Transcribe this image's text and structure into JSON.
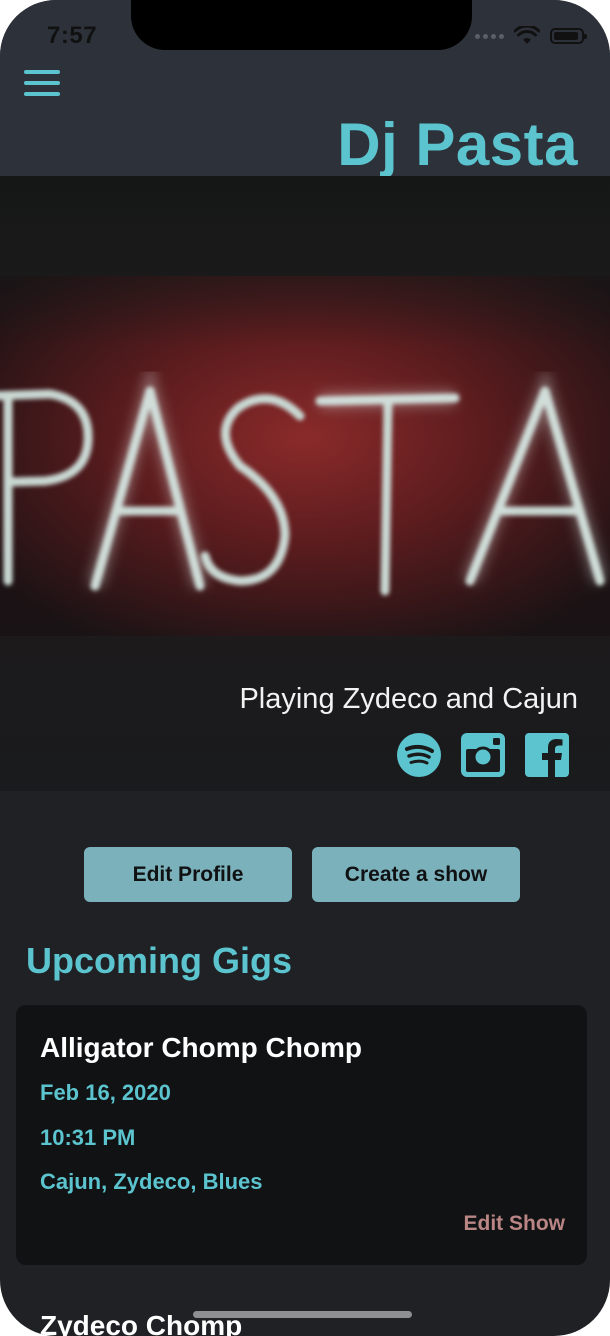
{
  "status_bar": {
    "time": "7:57"
  },
  "header": {
    "title": "Dj Pasta",
    "menu_icon": "hamburger-menu-icon"
  },
  "hero": {
    "sign_text": "PASTA",
    "tagline": "Playing Zydeco and Cajun",
    "socials": [
      {
        "icon": "spotify-icon"
      },
      {
        "icon": "instagram-icon"
      },
      {
        "icon": "facebook-icon"
      }
    ]
  },
  "actions": {
    "edit_profile": "Edit Profile",
    "create_show": "Create a show"
  },
  "gigs": {
    "section_title": "Upcoming Gigs",
    "items": [
      {
        "title": "Alligator Chomp Chomp",
        "date": "Feb 16, 2020",
        "time": "10:31 PM",
        "genres": "Cajun, Zydeco, Blues",
        "edit_label": "Edit Show"
      },
      {
        "title": "Zydeco Chomp"
      }
    ]
  },
  "colors": {
    "accent": "#5cc4cf",
    "header_bg": "#2d323a",
    "page_bg": "#1f2125",
    "card_bg": "#111213",
    "button_bg": "#7bb1bb",
    "edit_show": "#b98585"
  }
}
